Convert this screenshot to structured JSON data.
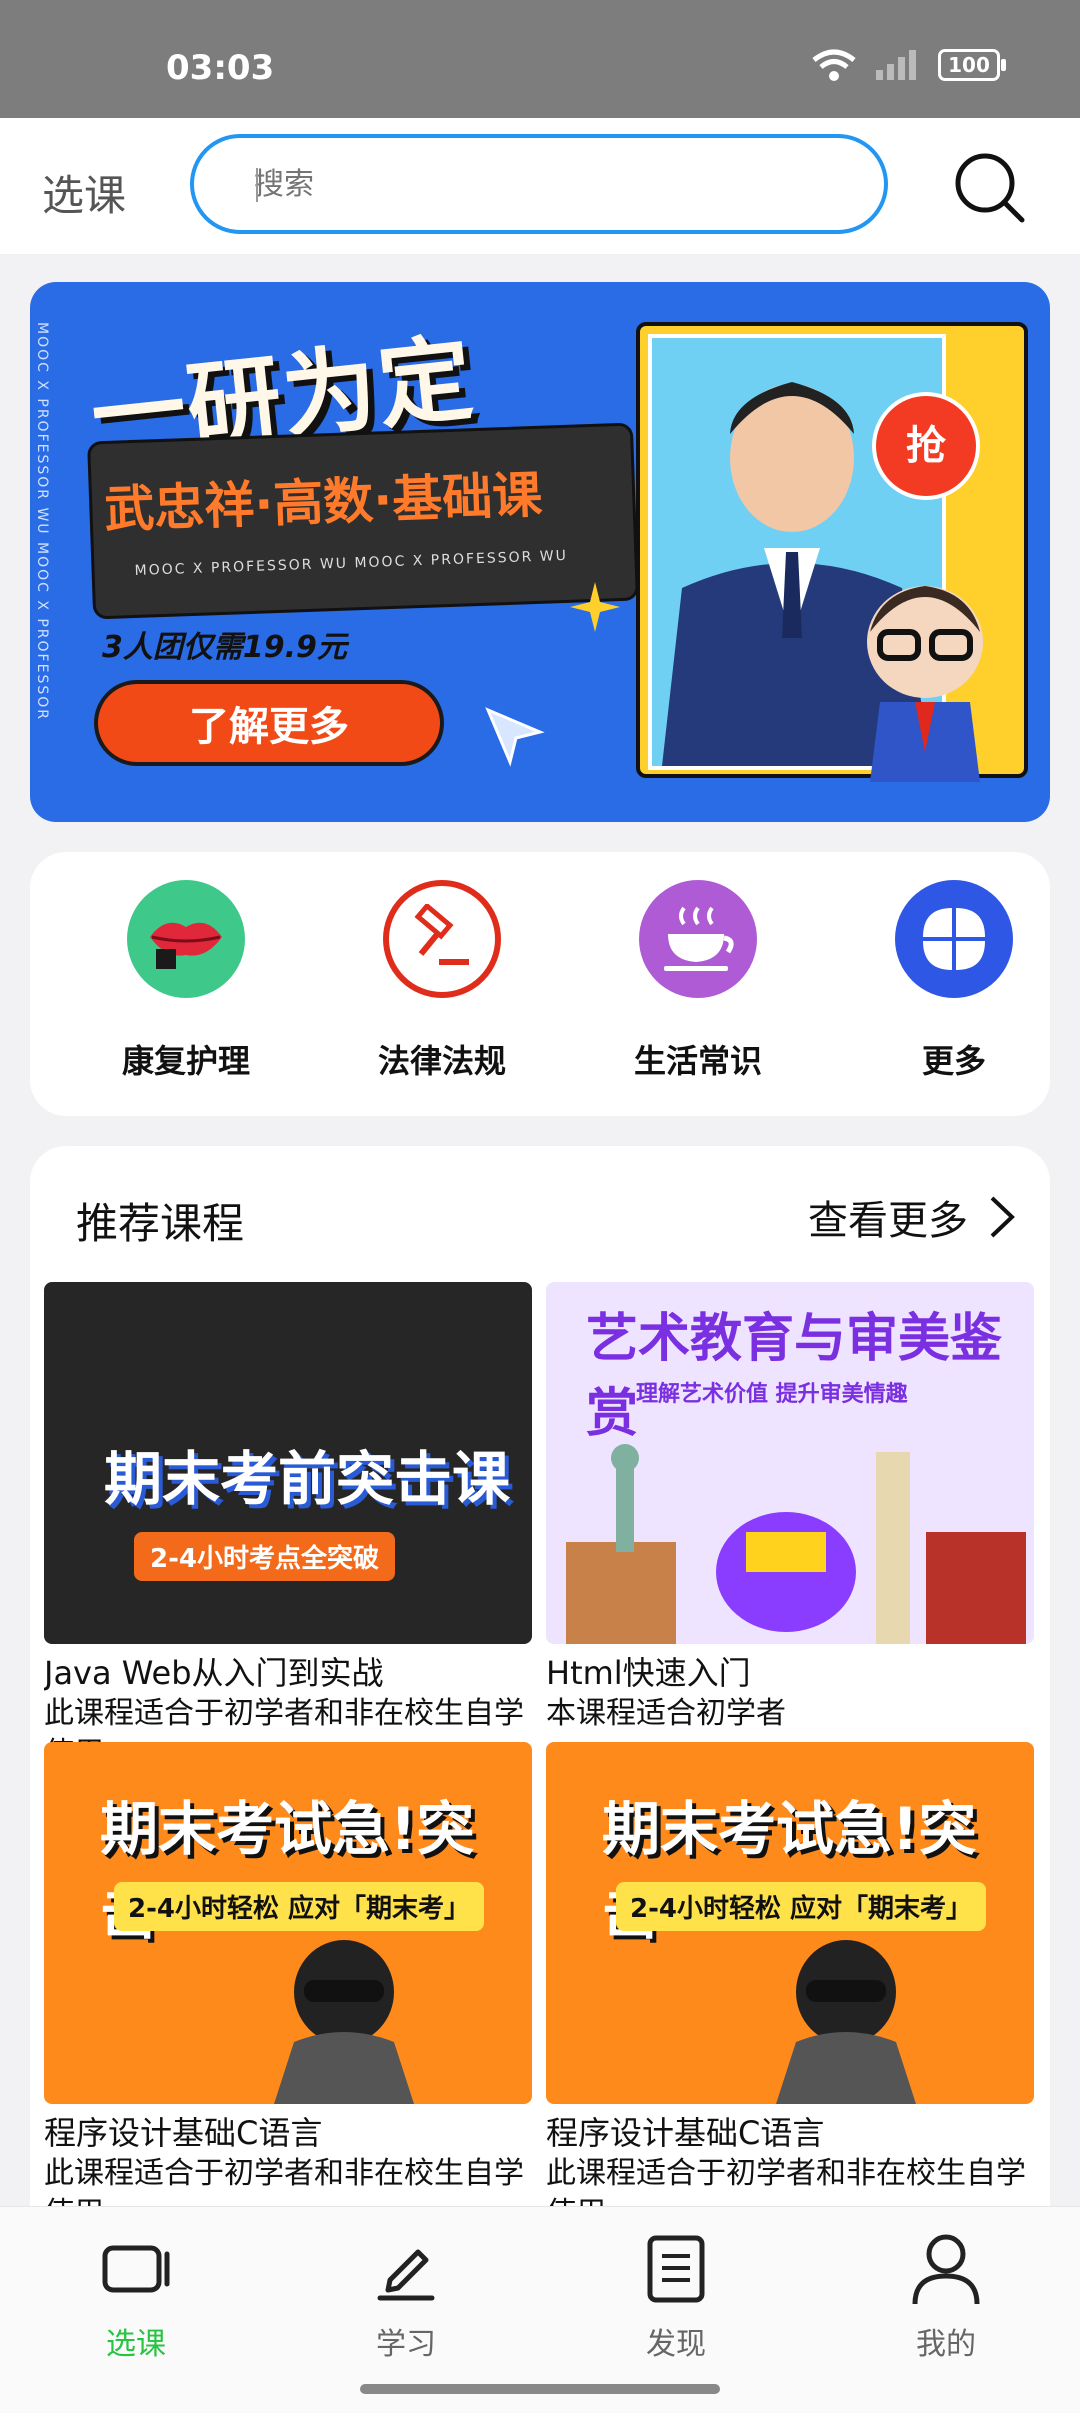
{
  "status_bar": {
    "time": "03:03",
    "battery": "100",
    "icons": [
      "wifi-icon",
      "signal-icon",
      "battery-icon"
    ]
  },
  "header": {
    "title": "选课",
    "search_placeholder": "搜索"
  },
  "banner": {
    "headline": "一研为定",
    "course_name": "武忠祥·高数·基础课",
    "tagline": "MOOC X PROFESSOR WU MOOC X PROFESSOR WU",
    "promo": "3人团仅需19.9元",
    "cta": "了解更多",
    "badge": "抢",
    "side_text": "MOOC X PROFESSOR WU MOOC X PROFESSOR"
  },
  "categories": [
    {
      "label": "康复护理",
      "icon": "lips-icon",
      "color": "#3ec98a"
    },
    {
      "label": "法律法规",
      "icon": "gavel-icon",
      "color": "#e02d1b"
    },
    {
      "label": "生活常识",
      "icon": "coffee-cup-icon",
      "color": "#b05bd6"
    },
    {
      "label": "更多",
      "icon": "four-petal-icon",
      "color": "#2e57e6"
    }
  ],
  "recommended": {
    "title": "推荐课程",
    "more": "查看更多",
    "courses": [
      {
        "title": "Java Web从入门到实战",
        "desc": "此课程适合于初学者和非在校生自学使用",
        "thumb_text": "期末考前突击课",
        "thumb_sub": "2-4小时考点全突破"
      },
      {
        "title": "Html快速入门",
        "desc": "本课程适合初学者",
        "thumb_text": "艺术教育与审美鉴赏",
        "thumb_sub": "理解艺术价值 提升审美情趣"
      },
      {
        "title": "程序设计基础C语言",
        "desc": "此课程适合于初学者和非在校生自学使用",
        "thumb_text": "期末考试急!突击",
        "thumb_sub": "2-4小时轻松 应对「期末考」"
      },
      {
        "title": "程序设计基础C语言",
        "desc": "此课程适合于初学者和非在校生自学使用",
        "thumb_text": "期末考试急!突击",
        "thumb_sub": "2-4小时轻松 应对「期末考」"
      }
    ]
  },
  "tabbar": {
    "items": [
      {
        "label": "选课",
        "icon": "course-select-icon",
        "active": true
      },
      {
        "label": "学习",
        "icon": "pen-icon",
        "active": false
      },
      {
        "label": "发现",
        "icon": "document-icon",
        "active": false
      },
      {
        "label": "我的",
        "icon": "person-icon",
        "active": false
      }
    ]
  },
  "colors": {
    "accent": "#2196f3",
    "active_tab": "#26c441",
    "banner_bg": "#2a6be6"
  }
}
